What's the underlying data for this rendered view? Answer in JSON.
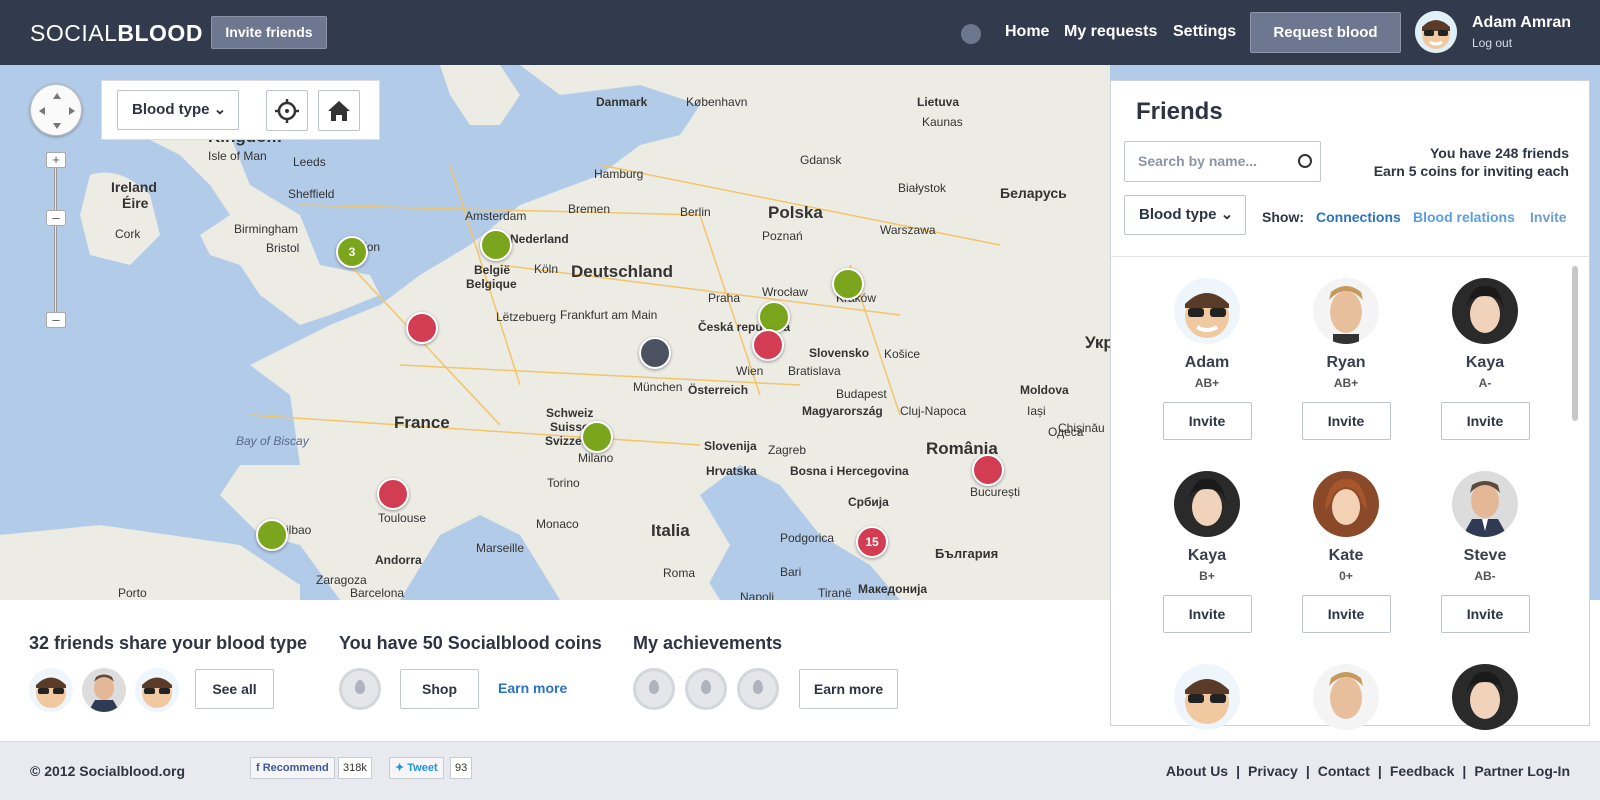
{
  "header": {
    "logo_light": "SOCIAL",
    "logo_bold": "BLOOD",
    "invite_label": "Invite friends",
    "nav": [
      "Home",
      "My requests",
      "Settings"
    ],
    "request_label": "Request blood",
    "user_name": "Adam Amran",
    "logout": "Log out",
    "accent": "#323a4d"
  },
  "map": {
    "blood_type_label": "Blood type",
    "cities": [
      {
        "name": "Danmark"
      },
      {
        "name": "København"
      },
      {
        "name": "Lietuva"
      },
      {
        "name": "Kaunas"
      },
      {
        "name": "Isle of Man"
      },
      {
        "name": "Leeds"
      },
      {
        "name": "Ireland"
      },
      {
        "name": "Éire"
      },
      {
        "name": "Sheffield"
      },
      {
        "name": "Cork"
      },
      {
        "name": "Birmingham"
      },
      {
        "name": "Bristol"
      },
      {
        "name": "London"
      },
      {
        "name": "Hamburg"
      },
      {
        "name": "Gdansk"
      },
      {
        "name": "Białystok"
      },
      {
        "name": "Bremen"
      },
      {
        "name": "Amsterdam"
      },
      {
        "name": "Nederland"
      },
      {
        "name": "Berlin"
      },
      {
        "name": "Poznań"
      },
      {
        "name": "Warszawa"
      },
      {
        "name": "Беларусь"
      },
      {
        "name": "België"
      },
      {
        "name": "Belgique"
      },
      {
        "name": "Köln"
      },
      {
        "name": "Wrocław"
      },
      {
        "name": "Lëtzebuerg"
      },
      {
        "name": "Frankfurt am Main"
      },
      {
        "name": "Praha"
      },
      {
        "name": "Kraków"
      },
      {
        "name": "Česká republika"
      },
      {
        "name": "Slovensko"
      },
      {
        "name": "Košice"
      },
      {
        "name": "München"
      },
      {
        "name": "Wien"
      },
      {
        "name": "Bratislava"
      },
      {
        "name": "Österreich"
      },
      {
        "name": "Budapest"
      },
      {
        "name": "Magyarország"
      },
      {
        "name": "Cluj-Napoca"
      },
      {
        "name": "Moldova"
      },
      {
        "name": "Iași"
      },
      {
        "name": "Chișinău"
      },
      {
        "name": "Schweiz"
      },
      {
        "name": "Suisse"
      },
      {
        "name": "Svizzera"
      },
      {
        "name": "Milano"
      },
      {
        "name": "Slovenija"
      },
      {
        "name": "Zagreb"
      },
      {
        "name": "Одеса"
      },
      {
        "name": "Bay of Biscay"
      },
      {
        "name": "Hrvatska"
      },
      {
        "name": "Torino"
      },
      {
        "name": "Bosna i Hercegovina"
      },
      {
        "name": "Србија"
      },
      {
        "name": "Bilbao"
      },
      {
        "name": "Toulouse"
      },
      {
        "name": "Monaco"
      },
      {
        "name": "Marseille"
      },
      {
        "name": "Italia"
      },
      {
        "name": "București"
      },
      {
        "name": "Andorra"
      },
      {
        "name": "Zaragoza"
      },
      {
        "name": "Roma"
      },
      {
        "name": "Napoli"
      },
      {
        "name": "Bari"
      },
      {
        "name": "Podgorica"
      },
      {
        "name": "България"
      },
      {
        "name": "Porto"
      },
      {
        "name": "Barcelona"
      },
      {
        "name": "Tiranë"
      },
      {
        "name": "Македонија"
      }
    ],
    "countries": [
      "Polska",
      "Deutschland",
      "France",
      "România",
      "Kingdom",
      "Укр"
    ],
    "pins": [
      {
        "type": "green",
        "label": "3"
      },
      {
        "type": "green",
        "label": ""
      },
      {
        "type": "red",
        "label": ""
      },
      {
        "type": "green",
        "label": ""
      },
      {
        "type": "green",
        "label": ""
      },
      {
        "type": "red",
        "label": ""
      },
      {
        "type": "dark",
        "label": ""
      },
      {
        "type": "green",
        "label": ""
      },
      {
        "type": "red",
        "label": ""
      },
      {
        "type": "red",
        "label": ""
      },
      {
        "type": "green",
        "label": ""
      },
      {
        "type": "red",
        "label": "15"
      }
    ]
  },
  "friends": {
    "title": "Friends",
    "search_placeholder": "Search by name...",
    "count_line": "You have 248 friends",
    "earn_line": "Earn 5 coins for inviting each",
    "blood_type_label": "Blood type",
    "show_label": "Show:",
    "filters": [
      "Connections",
      "Blood relations",
      "Invite"
    ],
    "invite_label": "Invite",
    "list": [
      {
        "name": "Adam",
        "blood": "AB+"
      },
      {
        "name": "Ryan",
        "blood": "AB+"
      },
      {
        "name": "Kaya",
        "blood": "A-"
      },
      {
        "name": "Kaya",
        "blood": "B+"
      },
      {
        "name": "Kate",
        "blood": "0+"
      },
      {
        "name": "Steve",
        "blood": "AB-"
      }
    ]
  },
  "bottom": {
    "share_title": "32 friends share your blood type",
    "see_all": "See all",
    "coins_title": "You have 50 Socialblood coins",
    "shop": "Shop",
    "earn_more_link": "Earn more",
    "achievements_title": "My achievements",
    "earn_more_button": "Earn more"
  },
  "footer": {
    "copyright": "© 2012 Socialblood.org",
    "recommend": "Recommend",
    "recommend_count": "318k",
    "tweet": "Tweet",
    "tweet_count": "93",
    "links": [
      "About Us",
      "Privacy",
      "Contact",
      "Feedback",
      "Partner Log-In"
    ]
  }
}
